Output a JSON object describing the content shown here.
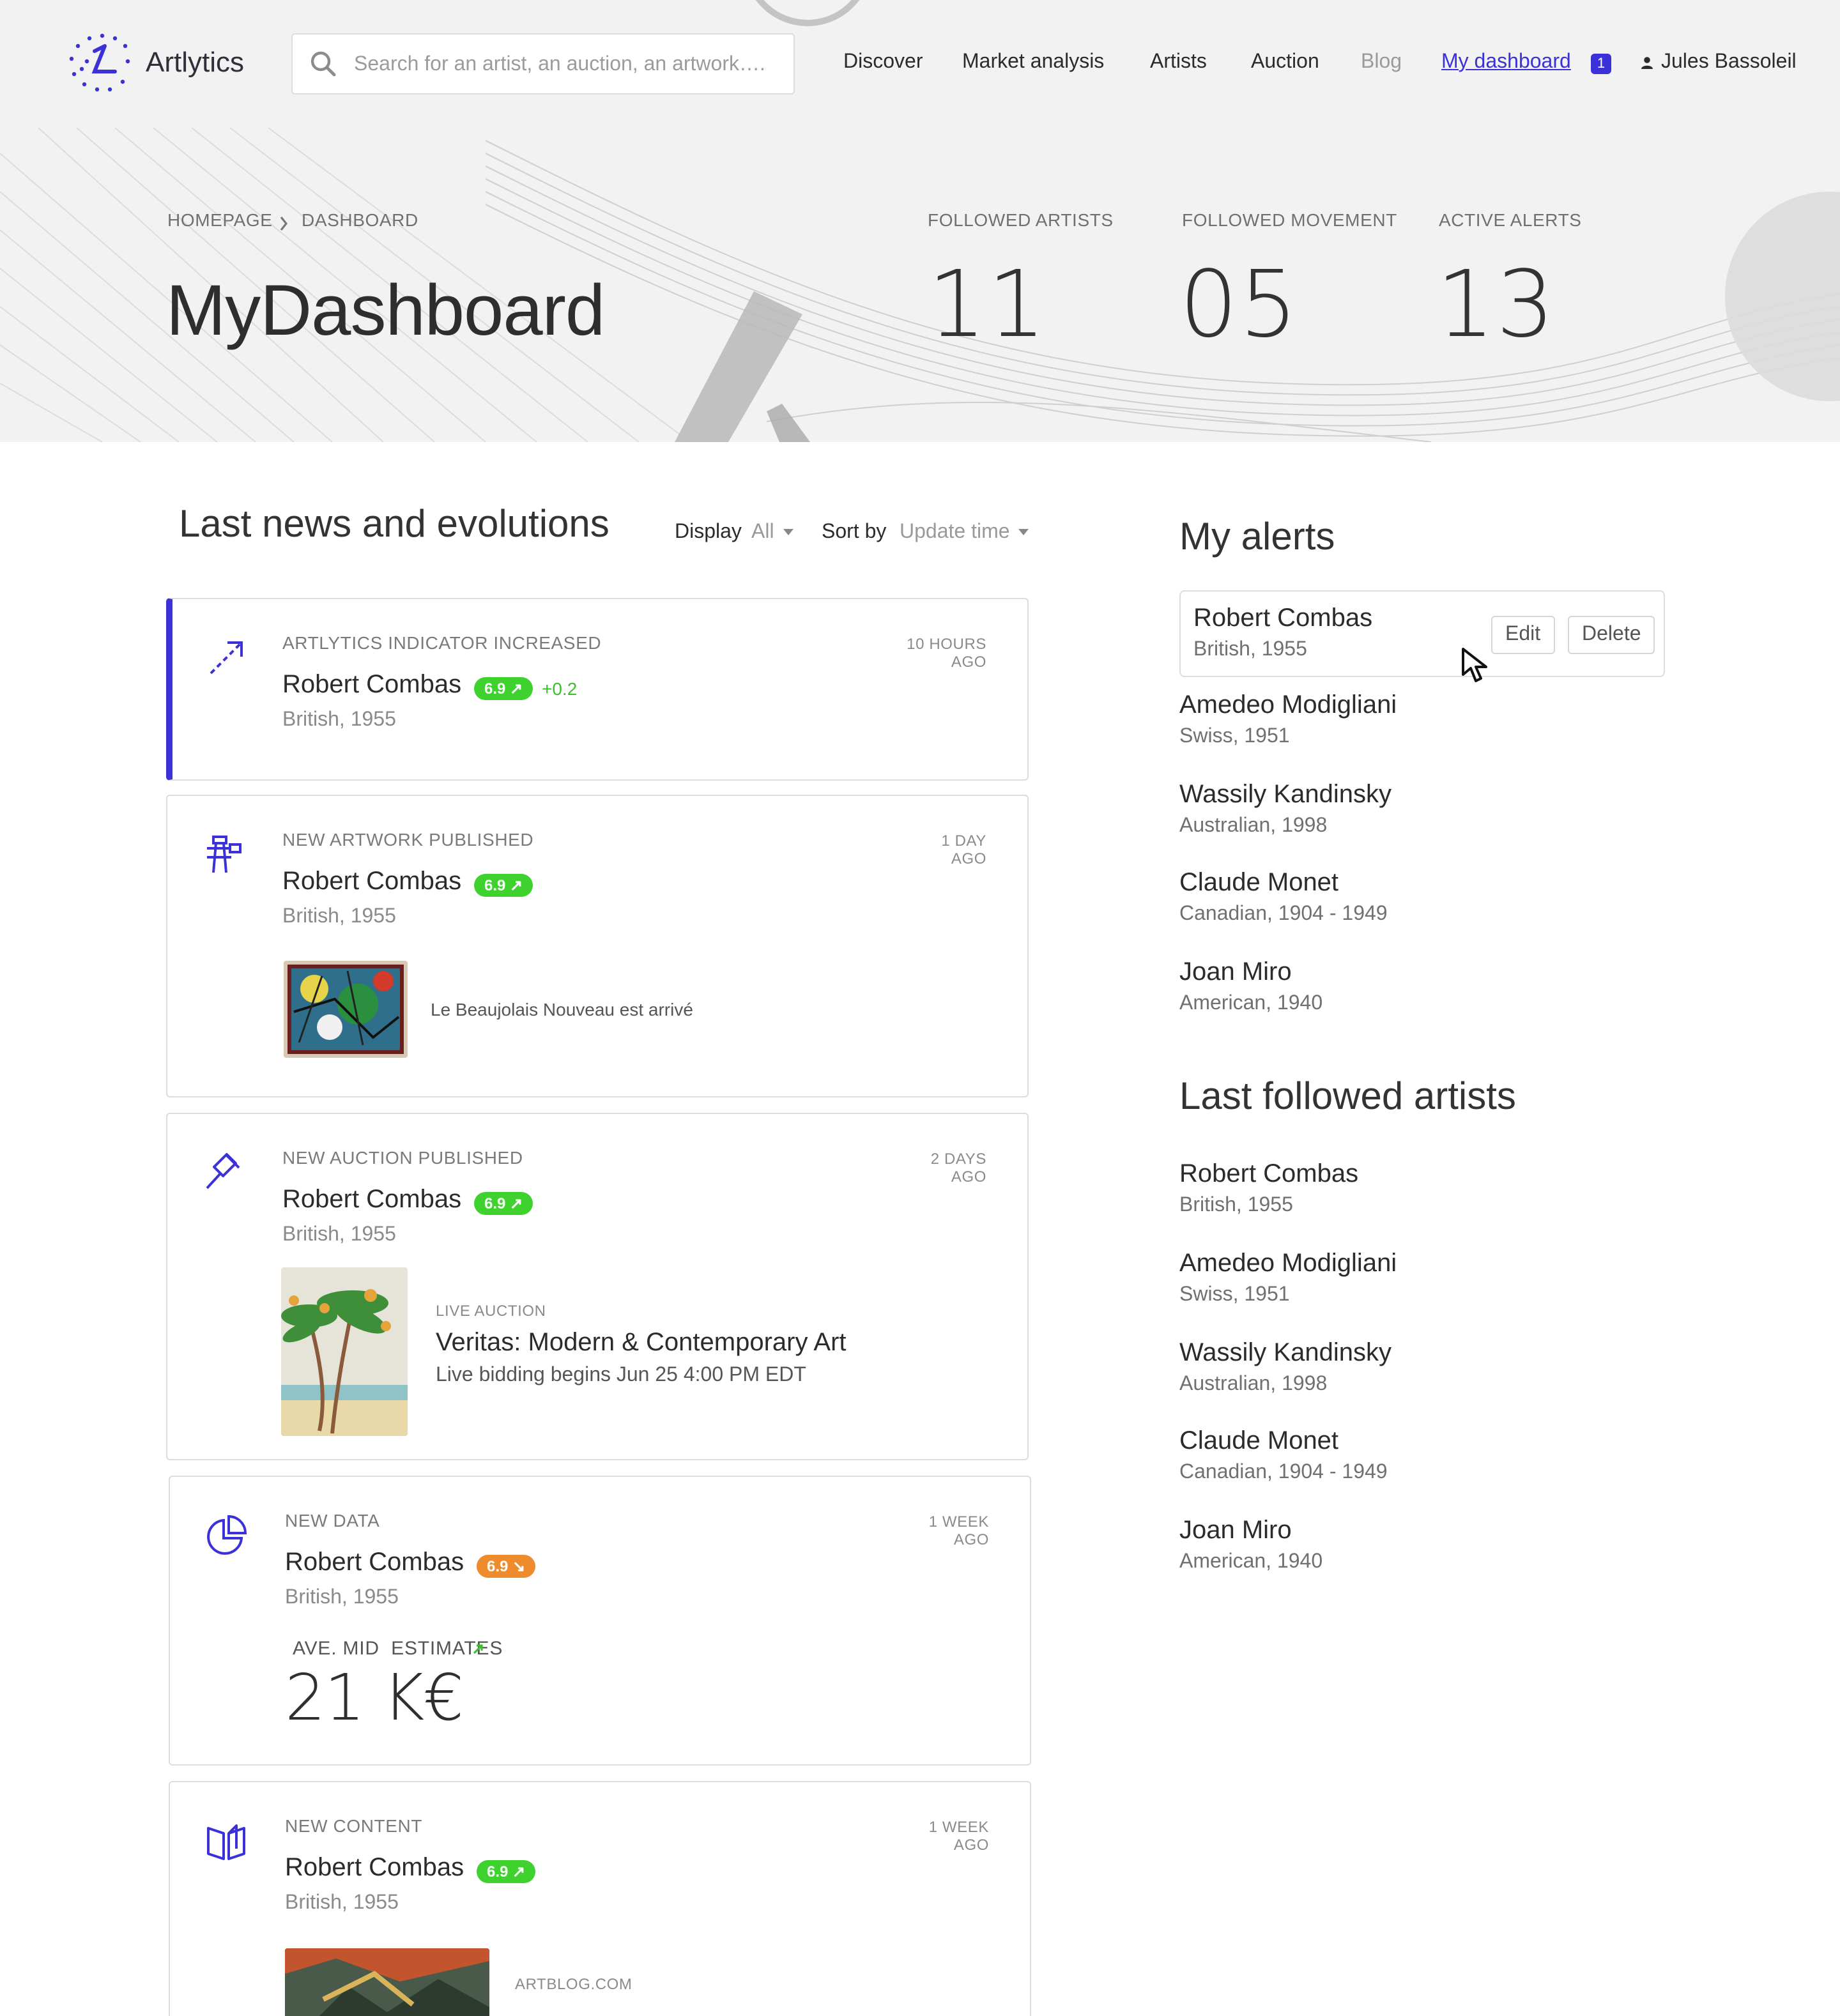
{
  "header": {
    "logo_text": "Artlytics",
    "search_placeholder": "Search for an artist, an auction, an artwork….",
    "nav": {
      "discover": "Discover",
      "market_analysis": "Market analysis",
      "artists": "Artists",
      "auction": "Auction",
      "blog": "Blog",
      "my_dashboard": "My dashboard",
      "dashboard_badge": "1"
    },
    "user_name": "Jules Bassoleil",
    "accent_color": "#3b31d8"
  },
  "hero": {
    "breadcrumb": [
      "HOMEPAGE",
      "DASHBOARD"
    ],
    "title": "MyDashboard",
    "stats": [
      {
        "label": "FOLLOWED ARTISTS",
        "value": "11"
      },
      {
        "label": "FOLLOWED MOVEMENT",
        "value": "05"
      },
      {
        "label": "ACTIVE ALERTS",
        "value": "13"
      }
    ]
  },
  "feed": {
    "title": "Last news and evolutions",
    "display_label": "Display",
    "display_value": "All",
    "sort_label": "Sort by",
    "sort_value": "Update time",
    "cards": [
      {
        "icon": "trend-arrow-icon",
        "type": "ARTLYTICS INDICATOR INCREASED",
        "time_top": "10 HOURS",
        "time_bottom": "AGO",
        "artist": "Robert Combas",
        "score": "6.9 ↗",
        "trend": "up",
        "delta": "+0.2",
        "sub": "British, 1955"
      },
      {
        "icon": "easel-icon",
        "type": "NEW ARTWORK PUBLISHED",
        "time_top": "1 DAY",
        "time_bottom": "AGO",
        "artist": "Robert Combas",
        "score": "6.9 ↗",
        "trend": "up",
        "sub": "British, 1955",
        "artwork_title": "Le Beaujolais Nouveau est arrivé"
      },
      {
        "icon": "gavel-icon",
        "type": "NEW AUCTION PUBLISHED",
        "time_top": "2 DAYS",
        "time_bottom": "AGO",
        "artist": "Robert Combas",
        "score": "6.9 ↗",
        "trend": "up",
        "sub": "British, 1955",
        "auction_kind": "LIVE AUCTION",
        "auction_title": "Veritas: Modern & Contemporary Art",
        "auction_detail": "Live bidding begins Jun 25 4:00 PM EDT"
      },
      {
        "icon": "pie-chart-icon",
        "type": "NEW DATA",
        "time_top": "1 WEEK",
        "time_bottom": "AGO",
        "artist": "Robert Combas",
        "score": "6.9 ↘",
        "trend": "down",
        "sub": "British, 1955",
        "metric_label": "AVE. MID  ESTIMATES",
        "metric_value": "21 K€"
      },
      {
        "icon": "book-icon",
        "type": "NEW CONTENT",
        "time_top": "1 WEEK",
        "time_bottom": "AGO",
        "artist": "Robert Combas",
        "score": "6.9 ↗",
        "trend": "up",
        "sub": "British, 1955",
        "source": "ARTBLOG.COM"
      }
    ]
  },
  "alerts": {
    "title": "My alerts",
    "edit_label": "Edit",
    "delete_label": "Delete",
    "items": [
      {
        "name": "Robert Combas",
        "sub": "British, 1955"
      },
      {
        "name": "Amedeo Modigliani",
        "sub": "Swiss, 1951"
      },
      {
        "name": "Wassily Kandinsky",
        "sub": "Australian, 1998"
      },
      {
        "name": "Claude Monet",
        "sub": "Canadian, 1904 - 1949"
      },
      {
        "name": "Joan Miro",
        "sub": "American, 1940"
      }
    ]
  },
  "followed": {
    "title": "Last followed artists",
    "items": [
      {
        "name": "Robert Combas",
        "sub": "British, 1955"
      },
      {
        "name": "Amedeo Modigliani",
        "sub": "Swiss, 1951"
      },
      {
        "name": "Wassily Kandinsky",
        "sub": "Australian, 1998"
      },
      {
        "name": "Claude Monet",
        "sub": "Canadian, 1904 - 1949"
      },
      {
        "name": "Joan Miro",
        "sub": "American, 1940"
      }
    ]
  }
}
